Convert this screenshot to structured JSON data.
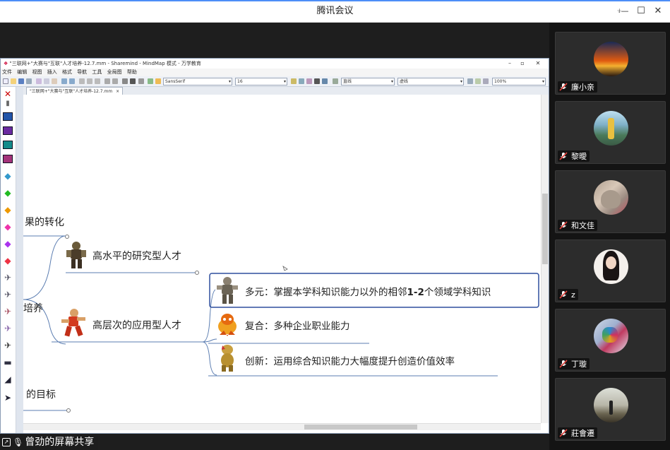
{
  "window": {
    "title": "腾讯会议",
    "controls": {
      "pin": "⍖",
      "minimize": "—",
      "maximize": "☐",
      "close": "✕"
    }
  },
  "mindmap": {
    "caption": "\"三联网+\"大赛与\"互联\"人才培养-12.7.mm - Sharemind - MindMap 模式 - 万学教育",
    "caption_controls": {
      "minimize": "–",
      "maximize": "▫",
      "close": "✕"
    },
    "menu": [
      "文件",
      "编辑",
      "视图",
      "插入",
      "格式",
      "导航",
      "工具",
      "全局图",
      "帮助"
    ],
    "toolbar": {
      "font_family": "SansSerif",
      "font_size": "16",
      "line_style": "直线",
      "edge_style": "虚线",
      "zoom": "100%"
    },
    "tab_label": "\"三联网+\"大赛与\"互联\"人才培养-12.7.mm",
    "tab_close": "×",
    "nodes": {
      "partial_top": "果的转化",
      "partial_mid": "培养",
      "partial_bottom": "的目标",
      "research_talent": "高水平的研究型人才",
      "applied_talent": "高层次的应用型人才",
      "sub_multi": "多元：掌握本学科知识能力以外的相邻",
      "sub_multi_bold": "1-2",
      "sub_multi_tail": "个领域学科知识",
      "sub_composite": "复合：多种企业职业能力",
      "sub_innovation": "创新：运用综合知识能力大幅度提升创造价值效率"
    }
  },
  "share_label": "曾劲的屏幕共享",
  "participants": [
    {
      "name": "廉小亲"
    },
    {
      "name": "黎曖"
    },
    {
      "name": "和文佳"
    },
    {
      "name": "z"
    },
    {
      "name": "丁璇"
    },
    {
      "name": "莊會遷"
    }
  ],
  "colors": {
    "accent": "#4c8ef7",
    "selected_border": "#2f4f9e",
    "edge": "#5b7db1",
    "tile_bg": "#2c2c2c",
    "mute_red": "#e0443e"
  }
}
